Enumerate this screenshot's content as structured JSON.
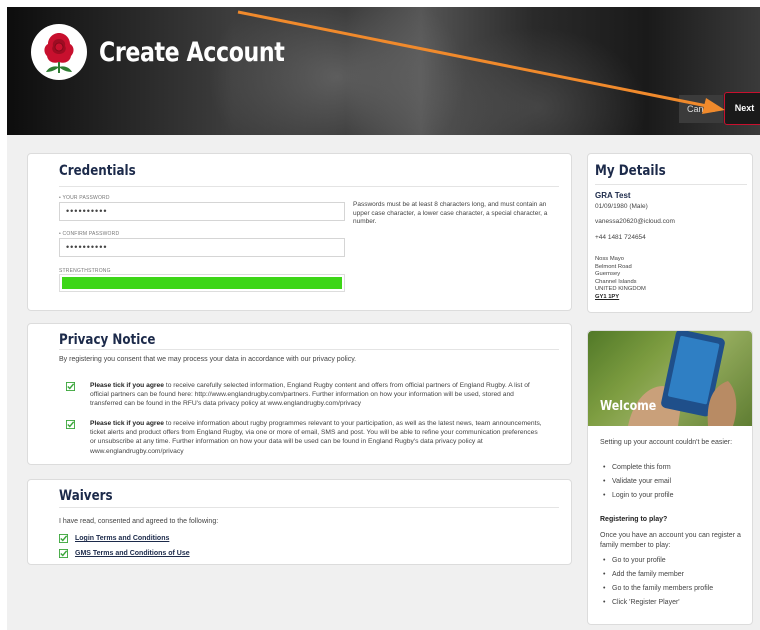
{
  "header": {
    "title": "Create Account",
    "cancel_label": "Cancel",
    "next_label": "Next"
  },
  "credentials": {
    "title": "Credentials",
    "password_label": "• YOUR PASSWORD",
    "password_value": "••••••••••",
    "confirm_label": "• CONFIRM PASSWORD",
    "confirm_value": "••••••••••",
    "password_hint": "Passwords must be at least 8 characters long, and must contain an upper case character, a lower case character, a special character, a number.",
    "strength_label": "STRENGTHSTRONG",
    "strength_level": 1.0,
    "strength_color": "#3dd617"
  },
  "privacy": {
    "title": "Privacy Notice",
    "intro": "By registering you consent that we may process your data in accordance with our privacy policy.",
    "items": [
      {
        "bold": "Please tick if you agree",
        "text": " to receive carefully selected information, England Rugby content and offers from official partners of England Rugby. A list of official partners can be found here: http://www.englandrugby.com/partners. Further information on how your information will be used, stored and transferred can be found in the RFU's data privacy policy at www.englandrugby.com/privacy",
        "checked": true
      },
      {
        "bold": "Please tick if you agree",
        "text": " to receive information about rugby programmes relevant to your participation, as well as the latest news, team announcements, ticket alerts and product offers from England Rugby, via one or more of email, SMS and post. You will be able to refine your communication preferences or unsubscribe at any time. Further information on how your data will be used can be found in England Rugby's data privacy policy at www.englandrugby.com/privacy",
        "checked": true
      }
    ]
  },
  "waivers": {
    "title": "Waivers",
    "intro": "I have read, consented and agreed to the following:",
    "links": [
      "Login Terms and Conditions",
      "GMS Terms and Conditions of Use"
    ]
  },
  "details": {
    "title": "My Details",
    "name": "GRA Test",
    "dob": "01/09/1980 (Male)",
    "email": "vanessa20620@icloud.com",
    "phone": "+44 1481 724654",
    "address": [
      "Noss Mayo",
      "Belmont Road",
      "Guernsey",
      "Channel Islands",
      "UNITED KINGDOM"
    ],
    "postcode": "GY1 1PY"
  },
  "welcome": {
    "title": "Welcome",
    "intro": "Setting up your account couldn't be easier:",
    "steps": [
      "Complete this form",
      "Validate your email",
      "Login to your profile"
    ],
    "play_heading": "Registering to play?",
    "play_intro": "Once you have an account you can register a family member to play:",
    "play_steps": [
      "Go to your profile",
      "Add the family member",
      "Go to the family members profile",
      "Click 'Register Player'"
    ]
  },
  "colors": {
    "accent": "#c8102e",
    "heading": "#1c2a4a",
    "check": "#3aa63a",
    "arrow": "#f08a2c"
  }
}
